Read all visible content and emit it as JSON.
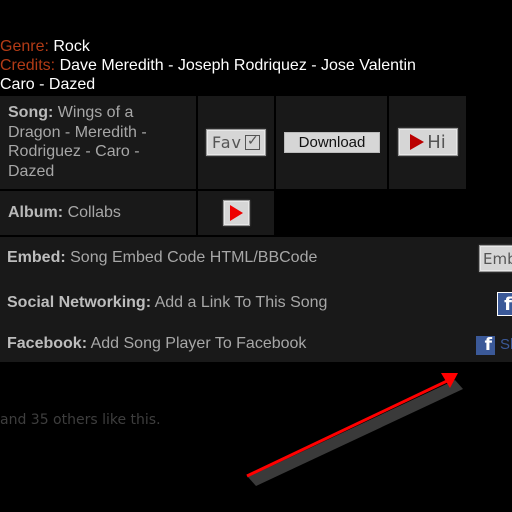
{
  "meta": {
    "genre_label": "Genre:",
    "genre_value": "Rock",
    "credits_label": "Credits:",
    "credits_value_line1": "Dave Meredith - Joseph Rodriquez - Jose Valentin",
    "credits_value_line2": "Caro - Dazed"
  },
  "song": {
    "label": "Song:",
    "line1": "Wings of a",
    "line2": "Dragon - Meredith -",
    "line3": "Rodriguez - Caro -",
    "line4": "Dazed",
    "fav_label": "Fav",
    "download_label": "Download",
    "hi_label": "Hi"
  },
  "album": {
    "label": "Album:",
    "value": "Collabs"
  },
  "embed": {
    "label": "Embed:",
    "value": "Song Embed Code HTML/BBCode",
    "button_label": "Emb"
  },
  "social": {
    "label": "Social Networking:",
    "value": "Add a Link To This Song"
  },
  "facebook": {
    "label": "Facebook:",
    "value": "Add Song Player To Facebook",
    "share_label": "Sh",
    "icon_letter": "f"
  },
  "likes_text": "and 35 others like this.",
  "colors": {
    "label_accent": "#b33b16",
    "annotation_arrow": "#ff0000",
    "facebook_blue": "#3b5998"
  }
}
